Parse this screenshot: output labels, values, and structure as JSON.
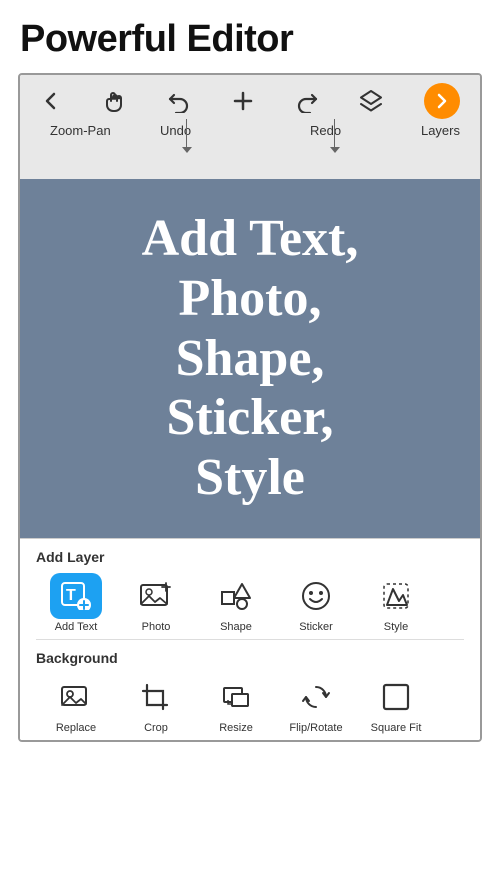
{
  "page": {
    "title": "Powerful Editor"
  },
  "toolbar": {
    "icons": [
      {
        "name": "back-arrow",
        "symbol": "←"
      },
      {
        "name": "hand-pan",
        "symbol": "☜"
      },
      {
        "name": "undo",
        "symbol": "↺"
      },
      {
        "name": "add",
        "symbol": "+"
      },
      {
        "name": "redo",
        "symbol": "↻"
      },
      {
        "name": "layers",
        "symbol": "◈"
      }
    ],
    "labels": {
      "zoom_pan": "Zoom-Pan",
      "undo": "Undo",
      "redo": "Redo",
      "layers": "Layers"
    }
  },
  "canvas": {
    "text": "Add Text,\nPhoto,\nShape,\nSticker,\nStyle"
  },
  "add_layer": {
    "label": "Add Layer",
    "items": [
      {
        "name": "add-text",
        "label": "Add Text",
        "active": true
      },
      {
        "name": "photo",
        "label": "Photo",
        "active": false
      },
      {
        "name": "shape",
        "label": "Shape",
        "active": false
      },
      {
        "name": "sticker",
        "label": "Sticker",
        "active": false
      },
      {
        "name": "style",
        "label": "Style",
        "active": false
      }
    ]
  },
  "background": {
    "label": "Background",
    "items": [
      {
        "name": "replace",
        "label": "Replace",
        "active": false
      },
      {
        "name": "crop",
        "label": "Crop",
        "active": false
      },
      {
        "name": "resize",
        "label": "Resize",
        "active": false
      },
      {
        "name": "flip-rotate",
        "label": "Flip/Rotate",
        "active": false
      },
      {
        "name": "square-fit",
        "label": "Square Fit",
        "active": false
      }
    ]
  }
}
